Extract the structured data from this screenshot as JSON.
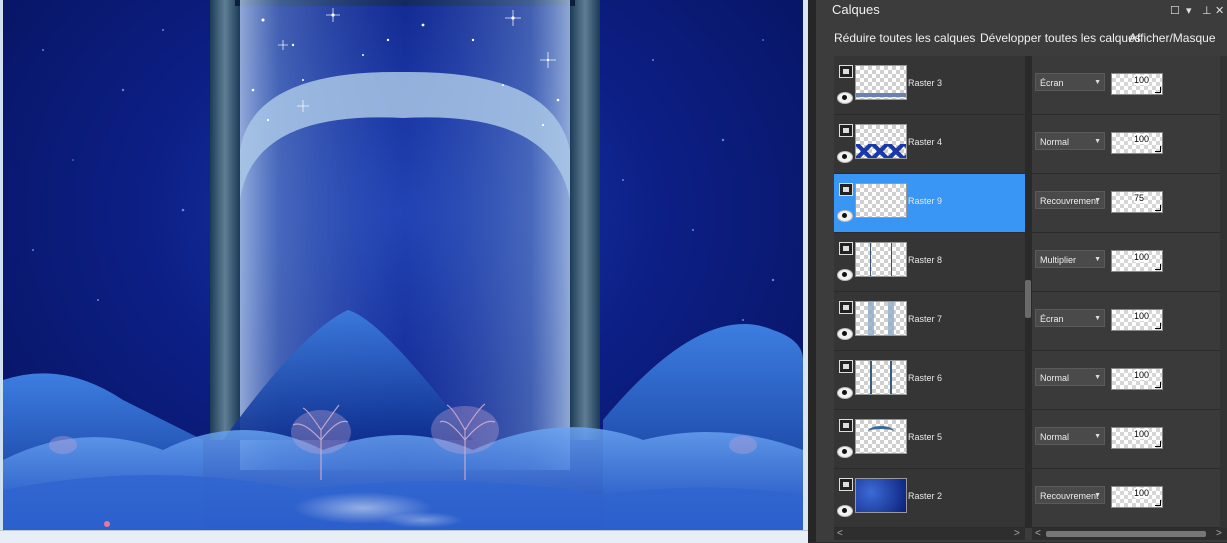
{
  "panel": {
    "title": "Calques",
    "controls": {
      "restore": "☐",
      "close": "✕",
      "pin": "⊥",
      "menu": "▾"
    }
  },
  "toolbar": {
    "collapse_all": "Réduire toutes les calques",
    "expand_all": "Développer toutes les calques",
    "show_mask": "Afficher/Masque"
  },
  "layers": [
    {
      "name": "Raster 3",
      "blend": "Écran",
      "opacity": "100",
      "selected": false
    },
    {
      "name": "Raster 4",
      "blend": "Normal",
      "opacity": "100",
      "selected": false
    },
    {
      "name": "Raster 9",
      "blend": "Recouvrement",
      "opacity": "75",
      "selected": true
    },
    {
      "name": "Raster 8",
      "blend": "Multiplier",
      "opacity": "100",
      "selected": false
    },
    {
      "name": "Raster 7",
      "blend": "Écran",
      "opacity": "100",
      "selected": false
    },
    {
      "name": "Raster 6",
      "blend": "Normal",
      "opacity": "100",
      "selected": false
    },
    {
      "name": "Raster 5",
      "blend": "Normal",
      "opacity": "100",
      "selected": false
    },
    {
      "name": "Raster 2",
      "blend": "Recouvrement",
      "opacity": "100",
      "selected": false
    }
  ],
  "scroll": {
    "left_arrow": "<",
    "right_arrow": ">"
  },
  "colors": {
    "selected_row": "#3a96f5",
    "canvas_bg": "#0c1f86"
  }
}
